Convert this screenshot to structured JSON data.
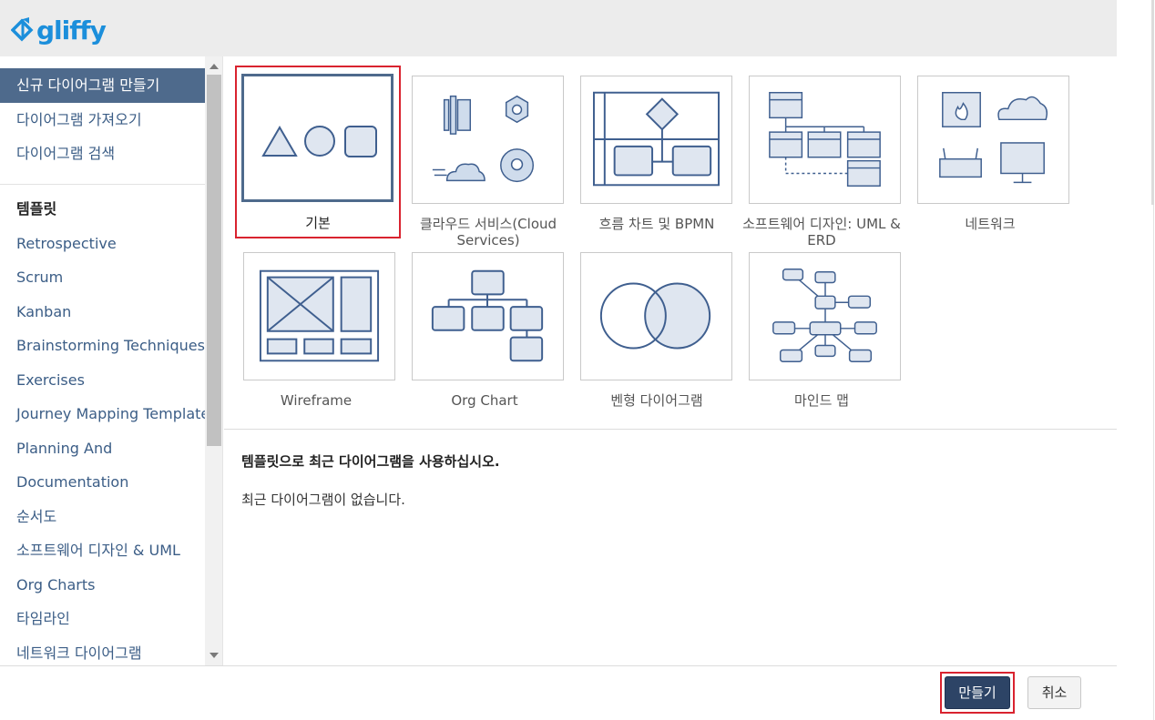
{
  "app": {
    "logo_text": "gliffy",
    "brand_color": "#1c8fdb"
  },
  "sidebar": {
    "top_items": [
      {
        "label": "신규 다이어그램 만들기",
        "active": true
      },
      {
        "label": "다이어그램 가져오기"
      },
      {
        "label": "다이어그램 검색"
      }
    ],
    "templates_heading": "템플릿",
    "template_items": [
      "Retrospective",
      "Scrum",
      "Kanban",
      "Brainstorming Techniques",
      "Exercises",
      "Journey Mapping Template",
      "Planning And",
      "Documentation",
      "순서도",
      "소프트웨어 디자인 & UML",
      "Org Charts",
      "타임라인",
      "네트워크 다이어그램"
    ]
  },
  "templates": [
    {
      "label": "기본",
      "selected": true,
      "icon": "shapes-icon"
    },
    {
      "label": "클라우드 서비스(Cloud Services)",
      "icon": "cloud-services-icon"
    },
    {
      "label": "흐름 차트 및 BPMN",
      "icon": "flowchart-icon"
    },
    {
      "label": "소프트웨어 디자인: UML & ERD",
      "icon": "uml-icon"
    },
    {
      "label": "네트워크",
      "icon": "network-icon"
    },
    {
      "label": "Wireframe",
      "icon": "wireframe-icon"
    },
    {
      "label": "Org Chart",
      "icon": "org-chart-icon"
    },
    {
      "label": "벤형 다이어그램",
      "icon": "venn-icon"
    },
    {
      "label": "마인드 맵",
      "icon": "mind-map-icon"
    }
  ],
  "recent": {
    "title": "템플릿으로 최근 다이어그램을 사용하십시오.",
    "empty_text": "최근 다이어그램이 없습니다."
  },
  "footer": {
    "create_label": "만들기",
    "cancel_label": "취소"
  },
  "colors": {
    "accent": "#4e6a8c",
    "icon_stroke": "#3f5f8f",
    "icon_fill": "#dfe6f0",
    "highlight": "#d9232f"
  }
}
